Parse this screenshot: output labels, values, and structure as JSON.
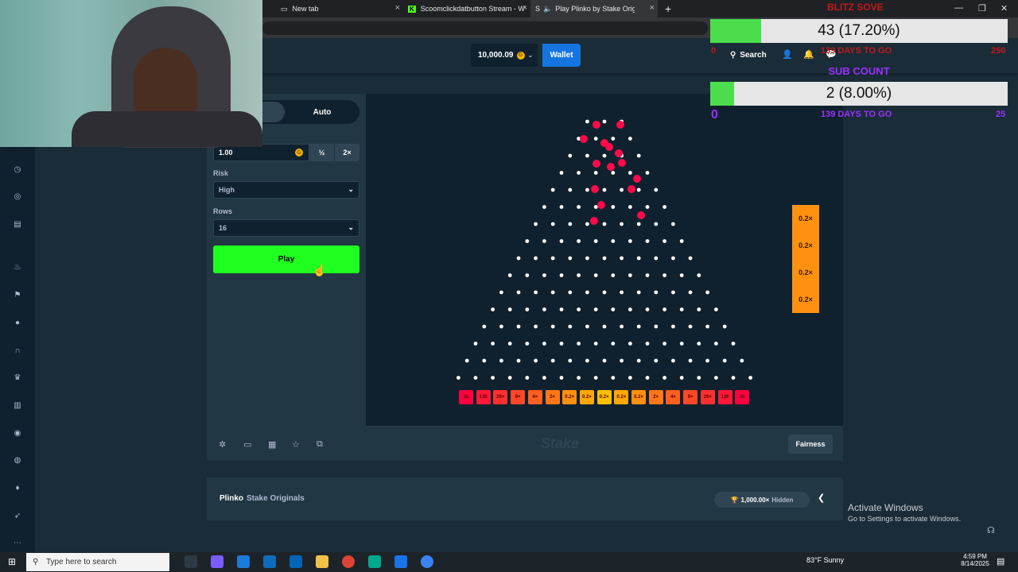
{
  "browser": {
    "tabs": [
      {
        "label": "New tab",
        "icon": "page-icon"
      },
      {
        "label": "Scoomclickdatbutton Stream - W",
        "icon": "kick-icon"
      },
      {
        "label": "Play Plinko by Stake Originals",
        "icon": "stake-icon"
      }
    ],
    "new_tab": "+",
    "win_min": "—",
    "win_max": "❐",
    "win_close": "✕"
  },
  "header": {
    "balance": "10,000.09",
    "coin": "G",
    "wallet_label": "Wallet",
    "search_label": "Search"
  },
  "controls": {
    "auto_tab": "Auto",
    "bet_amount": "1.00",
    "half_label": "½",
    "double_label": "2×",
    "risk_label": "Risk",
    "risk_value": "High",
    "rows_label": "Rows",
    "rows_value": "16",
    "play_label": "Play"
  },
  "board": {
    "rows": 16,
    "multipliers": [
      "1k",
      "130",
      "26×",
      "9×",
      "4×",
      "2×",
      "0.2×",
      "0.2×",
      "0.2×",
      "0.2×",
      "0.2×",
      "2×",
      "4×",
      "9×",
      "26×",
      "130",
      "1k"
    ],
    "bucket_colors": [
      "#ff003f",
      "#ff1837",
      "#ff302f",
      "#ff4827",
      "#ff6020",
      "#ff7818",
      "#ff9010",
      "#ffa808",
      "#ffc000",
      "#ffa808",
      "#ff9010",
      "#ff7818",
      "#ff6020",
      "#ff4827",
      "#ff302f",
      "#ff1837",
      "#ff003f"
    ],
    "history": [
      "0.2×",
      "0.2×",
      "0.2×",
      "0.2×"
    ]
  },
  "footer": {
    "fairness_label": "Fairness",
    "watermark": "Stake"
  },
  "info": {
    "game_name": "Plinko",
    "provider": "Stake Originals",
    "max_win": "1,000.00×",
    "hidden_label": "Hidden"
  },
  "overlay": {
    "goal1_title": "BLITZ SOVE",
    "goal1_text": "43 (17.20%)",
    "goal1_progress": 0.172,
    "goal1_start": "0",
    "goal1_days": "139 DAYS TO GO",
    "goal1_end": "250",
    "goal2_title": "SUB COUNT",
    "goal2_text": "2 (8.00%)",
    "goal2_progress": 0.08,
    "goal2_start": "0",
    "goal2_days": "139 DAYS TO GO",
    "goal2_end": "25",
    "activate_title": "Activate Windows",
    "activate_sub": "Go to Settings to activate Windows."
  },
  "taskbar": {
    "search_placeholder": "Type here to search",
    "weather": "83°F  Sunny",
    "time": "4:59 PM",
    "date": "8/14/2025"
  },
  "colors": {
    "bg": "#1a2c38",
    "panel": "#213743",
    "dark": "#0f212e",
    "play_green": "#1fff20",
    "wallet_blue": "#1475e1"
  }
}
